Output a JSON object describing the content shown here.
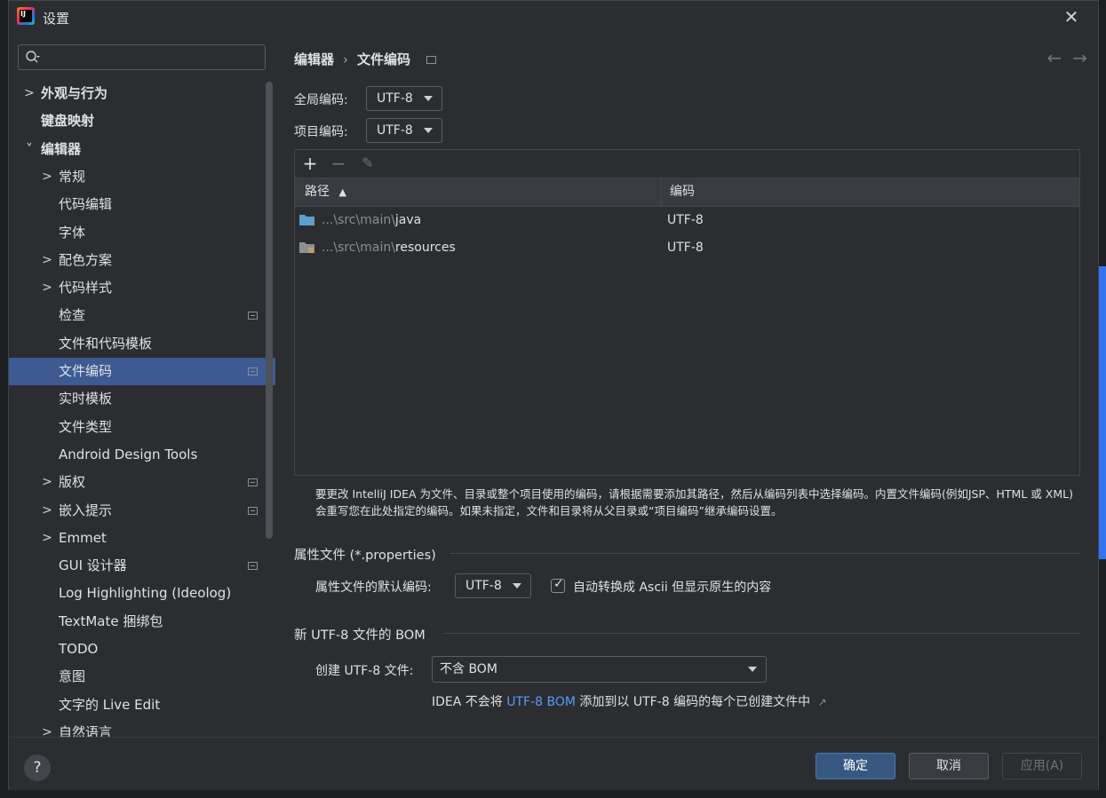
{
  "window": {
    "title": "设置"
  },
  "search": {
    "placeholder": ""
  },
  "sidebar": {
    "items": [
      {
        "label": "外观与行为",
        "chevron": "›",
        "bold": true
      },
      {
        "label": "键盘映射",
        "chevron": "",
        "bold": true
      },
      {
        "label": "编辑器",
        "chevron": "⌄",
        "bold": true
      },
      {
        "label": "常规",
        "chevron": "›"
      },
      {
        "label": "代码编辑",
        "chevron": ""
      },
      {
        "label": "字体",
        "chevron": ""
      },
      {
        "label": "配色方案",
        "chevron": "›"
      },
      {
        "label": "代码样式",
        "chevron": "›"
      },
      {
        "label": "检查",
        "chevron": "",
        "badge": true
      },
      {
        "label": "文件和代码模板",
        "chevron": ""
      },
      {
        "label": "文件编码",
        "chevron": "",
        "badge": true,
        "selected": true
      },
      {
        "label": "实时模板",
        "chevron": ""
      },
      {
        "label": "文件类型",
        "chevron": ""
      },
      {
        "label": "Android Design Tools",
        "chevron": ""
      },
      {
        "label": "版权",
        "chevron": "›",
        "badge": true
      },
      {
        "label": "嵌入提示",
        "chevron": "›",
        "badge": true
      },
      {
        "label": "Emmet",
        "chevron": "›"
      },
      {
        "label": "GUI 设计器",
        "chevron": "",
        "badge": true
      },
      {
        "label": "Log Highlighting (Ideolog)",
        "chevron": ""
      },
      {
        "label": "TextMate 捆绑包",
        "chevron": ""
      },
      {
        "label": "TODO",
        "chevron": ""
      },
      {
        "label": "意图",
        "chevron": ""
      },
      {
        "label": "文字的 Live Edit",
        "chevron": ""
      },
      {
        "label": "自然语言",
        "chevron": "›"
      }
    ]
  },
  "breadcrumb": {
    "parent": "编辑器",
    "separator": "›",
    "current": "文件编码"
  },
  "nav": {
    "back": "←",
    "forward": "→"
  },
  "global_encoding": {
    "label": "全局编码:",
    "value": "UTF-8"
  },
  "project_encoding": {
    "label": "项目编码:",
    "value": "UTF-8"
  },
  "table": {
    "toolbar": {
      "add": "+",
      "remove": "−",
      "edit": "✎"
    },
    "headers": {
      "path": "路径",
      "sort_indicator": "▲",
      "encoding": "编码"
    },
    "rows": [
      {
        "path_prefix": "...\\src\\main\\",
        "path_name": "java",
        "encoding": "UTF-8",
        "icon": "folder-icon"
      },
      {
        "path_prefix": "...\\src\\main\\",
        "path_name": "resources",
        "encoding": "UTF-8",
        "icon": "resources-folder-icon"
      }
    ]
  },
  "note": "要更改 IntelliJ IDEA 为文件、目录或整个项目使用的编码，请根据需要添加其路径，然后从编码列表中选择编码。内置文件编码(例如JSP、HTML 或 XML)会重写您在此处指定的编码。如果未指定，文件和目录将从父目录或“项目编码”继承编码设置。",
  "properties": {
    "section_title": "属性文件 (*.properties)",
    "default_label": "属性文件的默认编码:",
    "default_value": "UTF-8",
    "ascii_checkbox_label": "自动转换成 Ascii 但显示原生的内容",
    "ascii_checked": true
  },
  "bom": {
    "section_title": "新 UTF-8 文件的 BOM",
    "create_label": "创建 UTF-8 文件:",
    "create_value": "不含 BOM",
    "info_prefix": "IDEA 不会将 ",
    "info_link": "UTF-8 BOM",
    "info_suffix": " 添加到以 UTF-8 编码的每个已创建文件中",
    "info_arrow": "↗"
  },
  "footer": {
    "help": "?",
    "ok": "确定",
    "cancel": "取消",
    "apply": "应用(A)"
  },
  "colors": {
    "accent": "#3574f0",
    "selection": "#3d5a93",
    "link": "#589df6",
    "folder": "#5e9ecf"
  }
}
